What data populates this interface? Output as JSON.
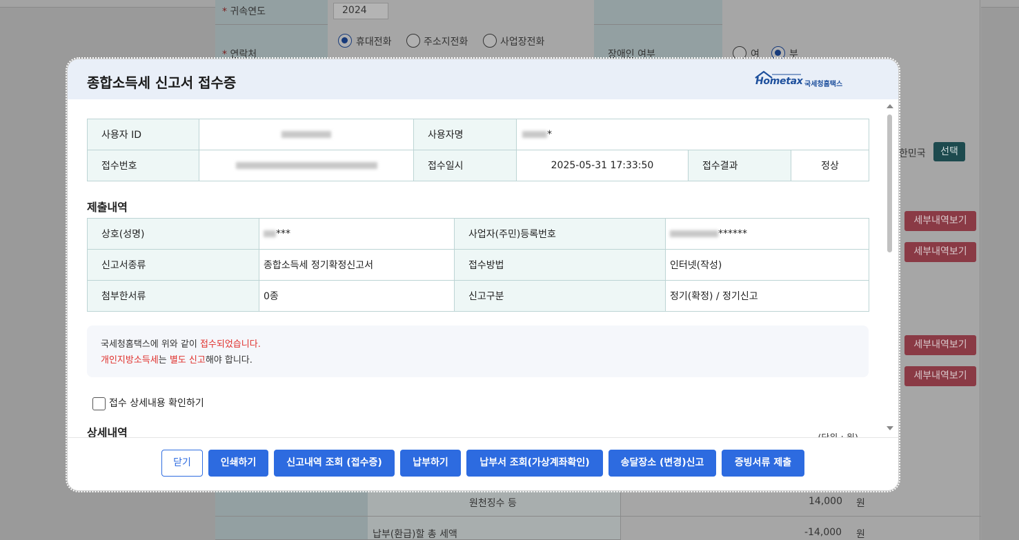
{
  "background": {
    "year_label": "귀속연도",
    "year_value": "2024",
    "contact_label": "연락처",
    "contact_options": [
      "휴대전화",
      "주소지전화",
      "사업장전화"
    ],
    "disability_label": "장애인 여부",
    "disability_options": [
      "여",
      "부"
    ],
    "country_text": "한민국",
    "select_button": "선택",
    "detail_button": "세부내역보기",
    "withholding_label": "원천징수 등",
    "withholding_value": "14,000",
    "total_label": "납부(환급)할 총 세액",
    "total_value": "-14,000",
    "won": "원"
  },
  "modal": {
    "title": "종합소득세 신고서 접수증",
    "logo_main": "Hometax",
    "logo_sub": "국세청홈택스",
    "receipt_table": {
      "user_id_label": "사용자 ID",
      "user_name_label": "사용자명",
      "user_name_suffix": "*",
      "receipt_no_label": "접수번호",
      "receipt_date_label": "접수일시",
      "receipt_date_value": "2025-05-31 17:33:50",
      "receipt_result_label": "접수결과",
      "receipt_result_value": "정상"
    },
    "submission_title": "제출내역",
    "submission_table": {
      "name_label": "상호(성명)",
      "name_suffix": "***",
      "reg_no_label": "사업자(주민)등록번호",
      "reg_no_suffix": "******",
      "form_type_label": "신고서종류",
      "form_type_value": "종합소득세 정기확정신고서",
      "method_label": "접수방법",
      "method_value": "인터넷(작성)",
      "attach_label": "첨부한서류",
      "attach_value": "0종",
      "category_label": "신고구분",
      "category_value": "정기(확정) / 정기신고"
    },
    "notice": {
      "line1_a": "국세청홈택스에 위와 같이 ",
      "line1_b": "접수되었습니다.",
      "line2_a": "개인지방소득세",
      "line2_b": "는 ",
      "line2_c": "별도 신고",
      "line2_d": "해야 합니다."
    },
    "detail_check_label": "접수 상세내용 확인하기",
    "detail_title": "상세내역",
    "unit_label": "(단위 : 원)",
    "buttons": {
      "close": "닫기",
      "print": "인쇄하기",
      "history": "신고내역 조회 (접수증)",
      "pay": "납부하기",
      "pay_slip": "납부서 조회(가상계좌확인)",
      "delivery": "송달장소 (변경)신고",
      "evidence": "증빙서류 제출"
    }
  }
}
